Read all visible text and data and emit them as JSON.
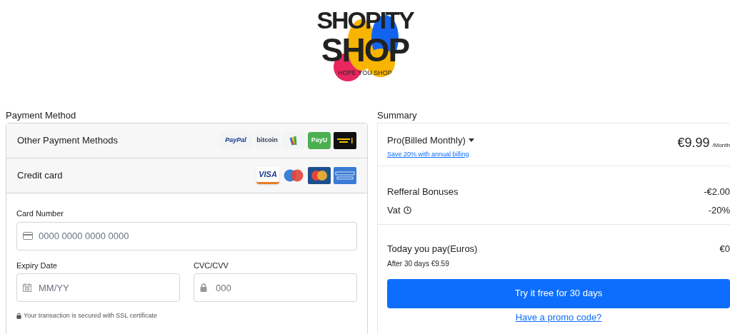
{
  "logo": {
    "line_1": "SHOPITY",
    "line_2": "SHOP",
    "tagline": "HOPE YOU SHOP"
  },
  "payment": {
    "heading": "Payment Method",
    "methods": [
      {
        "label": "Other Payment Methods",
        "logos": [
          {
            "kind": "paypal",
            "text": "PayPal"
          },
          {
            "kind": "bitcoin",
            "text": "bitcoin"
          },
          {
            "kind": "wallet"
          },
          {
            "kind": "payu",
            "text": "PayU"
          },
          {
            "kind": "western"
          }
        ]
      },
      {
        "label": "Credit card",
        "logos": [
          {
            "kind": "visa",
            "text": "VISA"
          },
          {
            "kind": "maestro"
          },
          {
            "kind": "mastercard"
          },
          {
            "kind": "amex"
          }
        ]
      }
    ],
    "card_number": {
      "label": "Card Number",
      "placeholder": "0000 0000 0000 0000"
    },
    "expiry": {
      "label": "Expiry Date",
      "placeholder": "MM/YY"
    },
    "cvc": {
      "label": "CVC/CVV",
      "placeholder": "000"
    },
    "secure_note": "Your transaction is secured with SSL certificate"
  },
  "summary": {
    "heading": "Summary",
    "plan": "Pro(Billed Monthly)",
    "save_link": "Save 20% with annual billing",
    "price": "€9.99",
    "period": "/Month",
    "lines": [
      {
        "label": "Refferal Bonuses",
        "value": "-€2.00",
        "info": false
      },
      {
        "label": "Vat",
        "value": "-20%",
        "info": true
      }
    ],
    "today_label": "Today you pay(Euros)",
    "today_value": "€0",
    "after": "After 30 days €9.59",
    "cta": "Try it free for 30 days",
    "promo_link": "Have a promo code?"
  }
}
